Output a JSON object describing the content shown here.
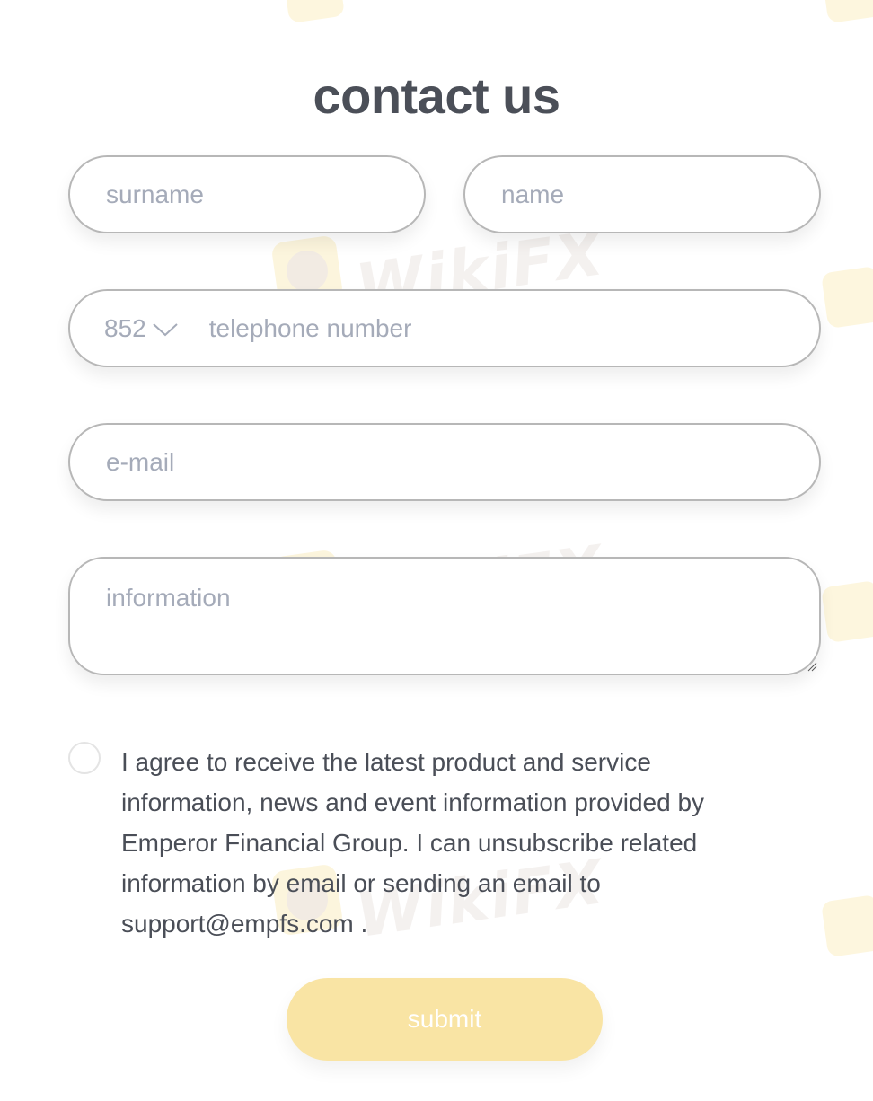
{
  "page": {
    "title": "contact us"
  },
  "form": {
    "surname_placeholder": "surname",
    "name_placeholder": "name",
    "phone": {
      "country_code": "852",
      "placeholder": "telephone number"
    },
    "email_placeholder": "e-mail",
    "information_placeholder": "information",
    "consent_text": "I agree to receive the latest product and service information, news and event information provided by Emperor Financial Group. I can unsubscribe related information  by email or sending an email to support@empfs.com .",
    "consent_checked": false,
    "submit_label": "submit"
  },
  "watermark": {
    "text": "WikiFX"
  },
  "colors": {
    "title": "#4b4f58",
    "placeholder": "#a5abb9",
    "field_border": "#b7b7b7",
    "submit_background": "#f9e4a4",
    "submit_text": "#ffffff"
  }
}
